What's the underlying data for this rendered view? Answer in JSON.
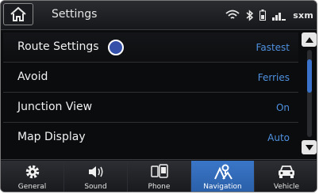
{
  "header": {
    "title": "Settings",
    "sxm_label": "sxm",
    "icons": [
      "home-icon",
      "wifi-icon",
      "bluetooth-icon",
      "battery-icon",
      "signal-icon"
    ]
  },
  "settings": [
    {
      "label": "Route Settings",
      "value": "Fastest"
    },
    {
      "label": "Avoid",
      "value": "Ferries"
    },
    {
      "label": "Junction View",
      "value": "On"
    },
    {
      "label": "Map Display",
      "value": "Auto"
    }
  ],
  "tabs": [
    {
      "label": "General",
      "icon": "gear-icon"
    },
    {
      "label": "Sound",
      "icon": "speaker-icon"
    },
    {
      "label": "Phone",
      "icon": "phone-icon"
    },
    {
      "label": "Navigation",
      "icon": "navigation-pin-icon",
      "active": true
    },
    {
      "label": "Vehicle",
      "icon": "car-icon"
    }
  ],
  "colors": {
    "accent": "#3b72cc",
    "value_text": "#4f91e0",
    "active_tab": "#3a76c8"
  }
}
